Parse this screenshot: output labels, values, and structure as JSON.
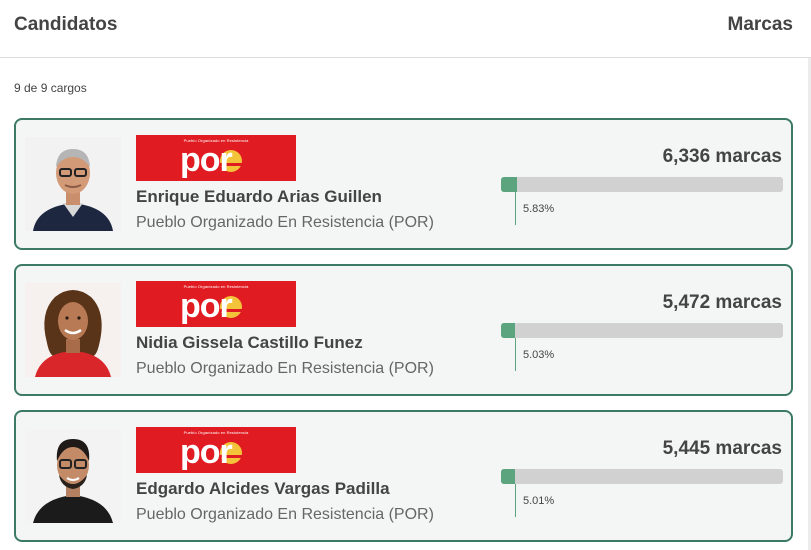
{
  "header": {
    "left_title": "Candidatos",
    "right_title": "Marcas"
  },
  "summary": {
    "count_text": "9 de 9 cargos"
  },
  "colors": {
    "card_border": "#3c7a64",
    "bar_fill": "#5ba47e",
    "bar_track": "#d1d1d1",
    "party_red": "#e11b22",
    "party_sun": "#f3c33a"
  },
  "candidates": [
    {
      "name": "Enrique Eduardo Arias Guillen",
      "party": "Pueblo Organizado En Resistencia (POR)",
      "votes": "6,336 marcas",
      "percent_text": "5.83%",
      "percent_value": 5.83,
      "logo": {
        "tagline": "Pueblo Organizado en Resistencia",
        "mark": "por"
      }
    },
    {
      "name": "Nidia Gissela Castillo Funez",
      "party": "Pueblo Organizado En Resistencia (POR)",
      "votes": "5,472 marcas",
      "percent_text": "5.03%",
      "percent_value": 5.03,
      "logo": {
        "tagline": "Pueblo Organizado en Resistencia",
        "mark": "por"
      }
    },
    {
      "name": "Edgardo Alcides Vargas Padilla",
      "party": "Pueblo Organizado En Resistencia (POR)",
      "votes": "5,445 marcas",
      "percent_text": "5.01%",
      "percent_value": 5.01,
      "logo": {
        "tagline": "Pueblo Organizado en Resistencia",
        "mark": "por"
      }
    }
  ]
}
